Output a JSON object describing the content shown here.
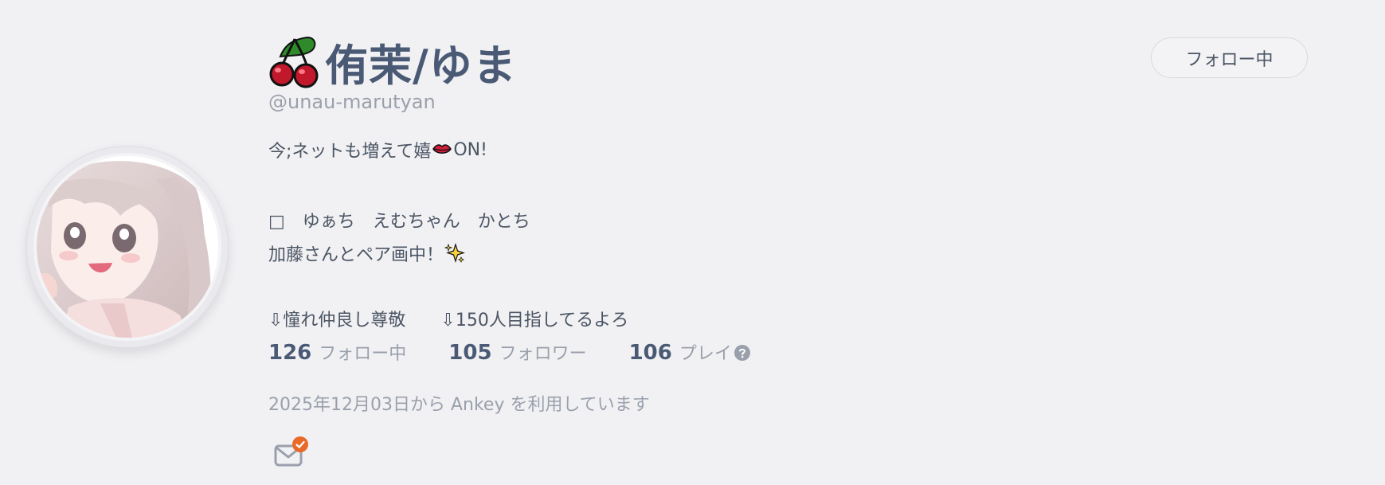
{
  "profile": {
    "display_name": "侑茉/ゆま",
    "handle": "@unau-marutyan",
    "name_icon": "cherries-icon",
    "avatar_icon": "anime-girl-avatar"
  },
  "follow_button": {
    "label": "フォロー中"
  },
  "bio": {
    "line1_text": "今;ネットも増えて嬉",
    "line1_emoji": "lips-icon",
    "line1_suffix": "ON!",
    "line2": "□　ゆぁち　えむちゃん　かとち",
    "line3_text": "加藤さんとペア画中！",
    "line3_emoji": "sparkles-icon",
    "line4": "⇩憧れ仲良し尊敬　　⇩150人目指してるよろ"
  },
  "stats": {
    "following_count": "126",
    "following_label": "フォロー中",
    "followers_count": "105",
    "followers_label": "フォロワー",
    "plays_count": "106",
    "plays_label": "プレイ",
    "plays_help_icon": "question-circle-icon"
  },
  "joined_text": "2025年12月03日から Ankey を利用しています",
  "mail": {
    "icon": "mail-icon",
    "badge_icon": "check-badge-icon"
  },
  "colors": {
    "background": "#f1f1f4",
    "name": "#4a5a75",
    "muted": "#9aa0ab",
    "text": "#4b5563",
    "badge": "#e8692a"
  }
}
